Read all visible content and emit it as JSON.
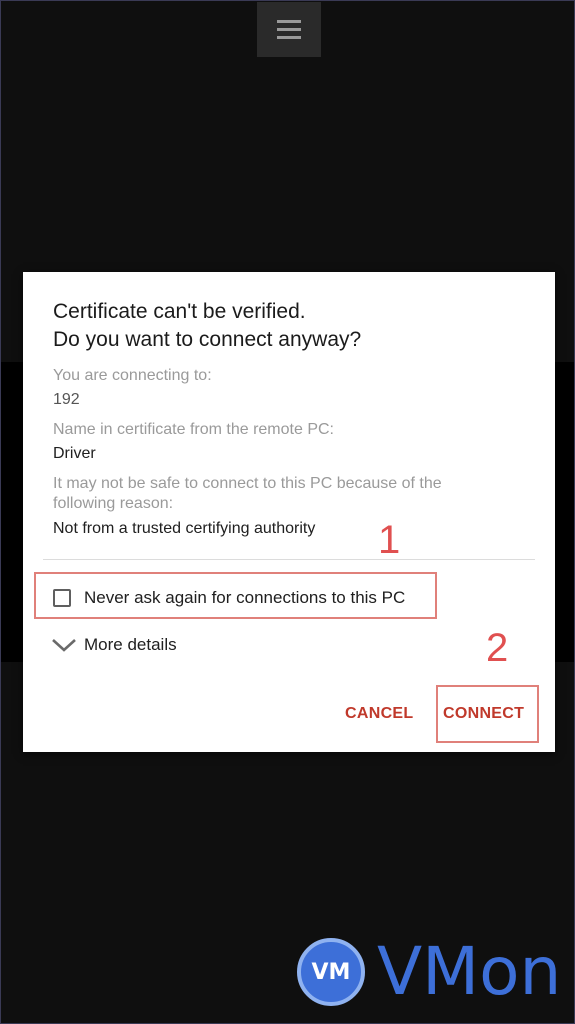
{
  "dialog": {
    "title_line1": "Certificate can't be verified.",
    "title_line2": "Do you want to connect anyway?",
    "connecting_label": "You are connecting to:",
    "connecting_value": "192",
    "cert_name_label": "Name in certificate from the remote PC:",
    "cert_name_value": "Driver",
    "reason_label": "It may not be safe to connect to this PC because of the following reason:",
    "reason_value": "Not from a trusted certifying authority",
    "checkbox_label": "Never ask again for connections to this PC",
    "checkbox_checked": false,
    "more_details_label": "More details",
    "cancel_label": "CANCEL",
    "connect_label": "CONNECT"
  },
  "annotations": {
    "step1": "1",
    "step2": "2"
  },
  "watermark": {
    "logo_badge": "VM",
    "logo_text": "VMon"
  },
  "icons": {
    "menu": "hamburger-menu-icon",
    "expand": "chevron-down-icon",
    "checkbox": "checkbox-unchecked-icon"
  },
  "colors": {
    "accent": "#c0392b",
    "annotation": "#e05050",
    "logo": "#3d6fd8"
  }
}
